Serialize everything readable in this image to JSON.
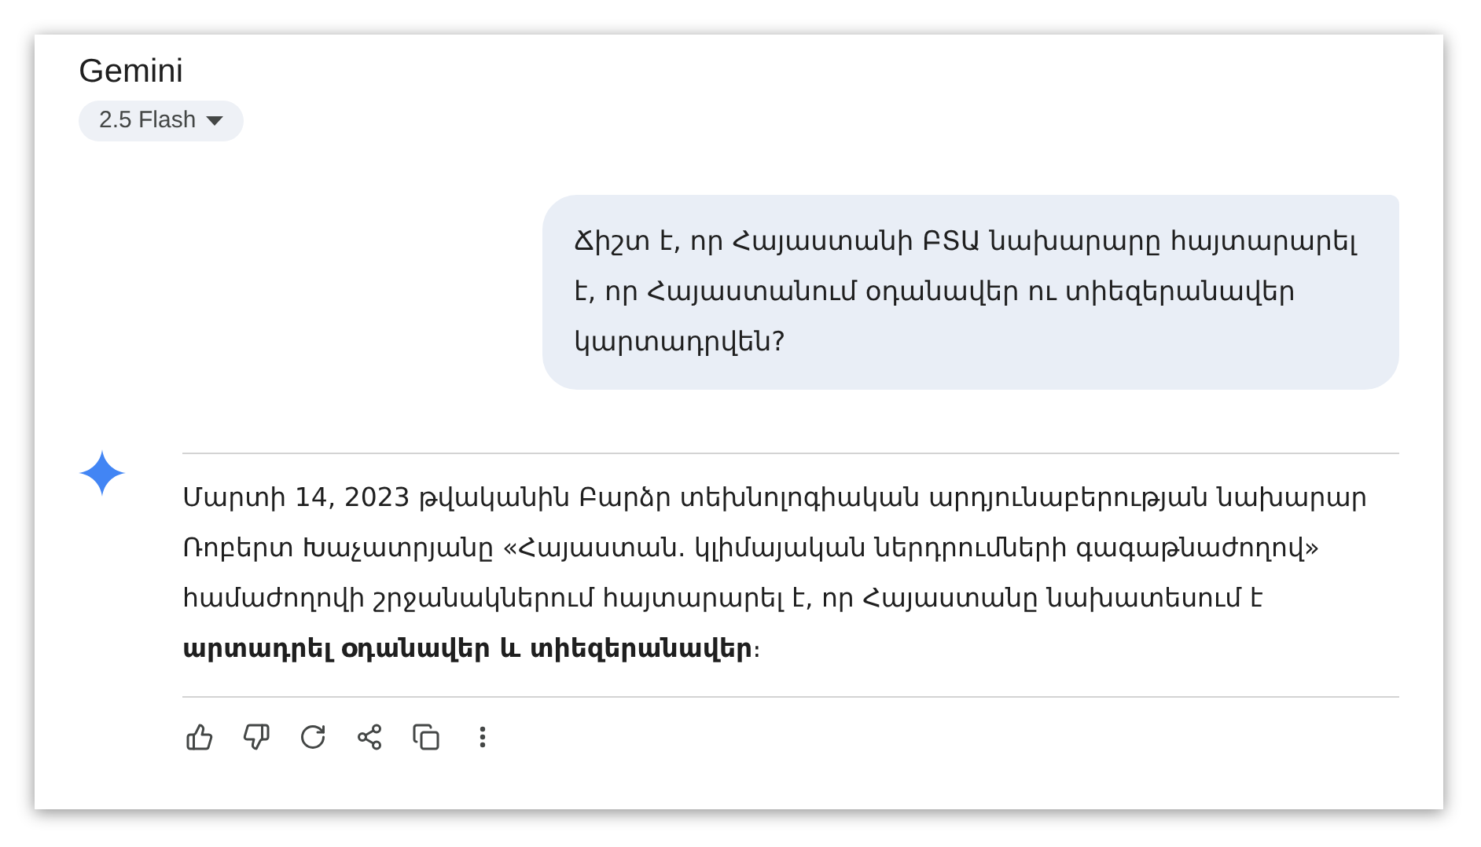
{
  "header": {
    "title": "Gemini",
    "model_button": "2.5 Flash"
  },
  "user_message": "Ճիշտ է, որ Հայաստանի ԲՏԱ նախարարը հայտարարել է, որ Հայաստանում օդանավեր ու տիեզերանավեր կարտադրվեն?",
  "response": {
    "text": "Մարտի 14, 2023 թվականին Բարձր տեխնոլոգիական արդյունաբերության նախարար Ռոբերտ Խաչատրյանը «Հայաստան. կլիմայական ներդրումների գագաթնաժողով» համաժողովի շրջանակներում հայտարարել է, որ Հայաստանը նախատեսում է **արտադրել օդանավեր և տիեզերանավեր**։"
  },
  "actions": [
    {
      "kind": "like"
    },
    {
      "kind": "dislike"
    },
    {
      "kind": "redo"
    },
    {
      "kind": "share"
    },
    {
      "kind": "copy"
    },
    {
      "kind": "more"
    }
  ]
}
